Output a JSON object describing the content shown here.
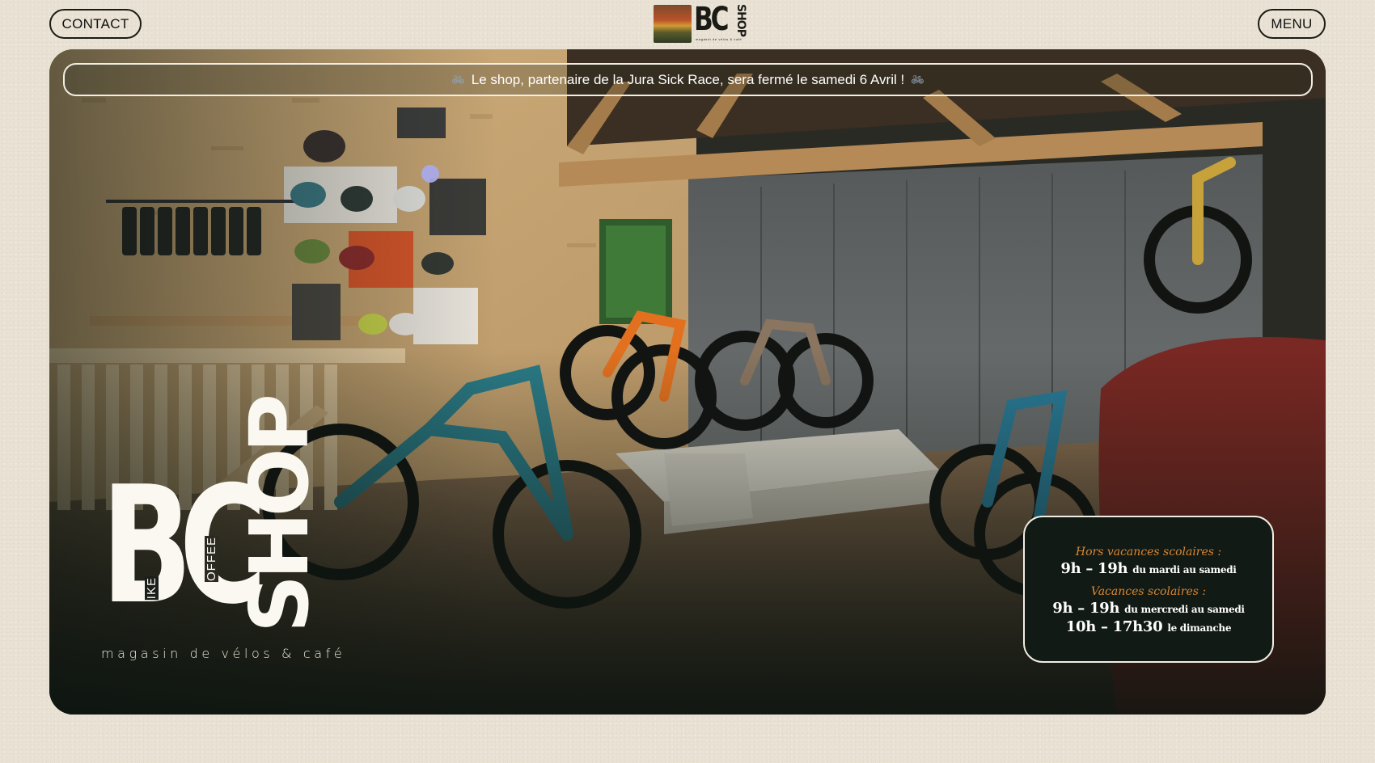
{
  "header": {
    "contact_label": "CONTACT",
    "menu_label": "MENU",
    "logo": {
      "mark": "BC",
      "word": "SHOP",
      "subtitle": "magasin de vélos & café"
    }
  },
  "banner": {
    "icon": "bicycle-icon",
    "text": "Le shop, partenaire de la Jura Sick Race, sera fermé le samedi 6 Avril !"
  },
  "hero": {
    "image": "bike-shop-interior-photo",
    "logo": {
      "mark": "BC",
      "bike": "IKE",
      "coffee": "OFFEE",
      "word": "SHOP",
      "tagline": "magasin de vélos & café"
    }
  },
  "hours": {
    "label_off": "Hors vacances scolaires :",
    "line1_time": "9h – 19h",
    "line1_days": "du mardi au samedi",
    "label_holidays": "Vacances scolaires :",
    "line2_time": "9h – 19h",
    "line2_days": "du mercredi au samedi",
    "line3_time": "10h – 17h30",
    "line3_days": "le dimanche"
  },
  "colors": {
    "background": "#e9e2d4",
    "hours_label": "#d98734",
    "hero_dark": "#182019"
  }
}
